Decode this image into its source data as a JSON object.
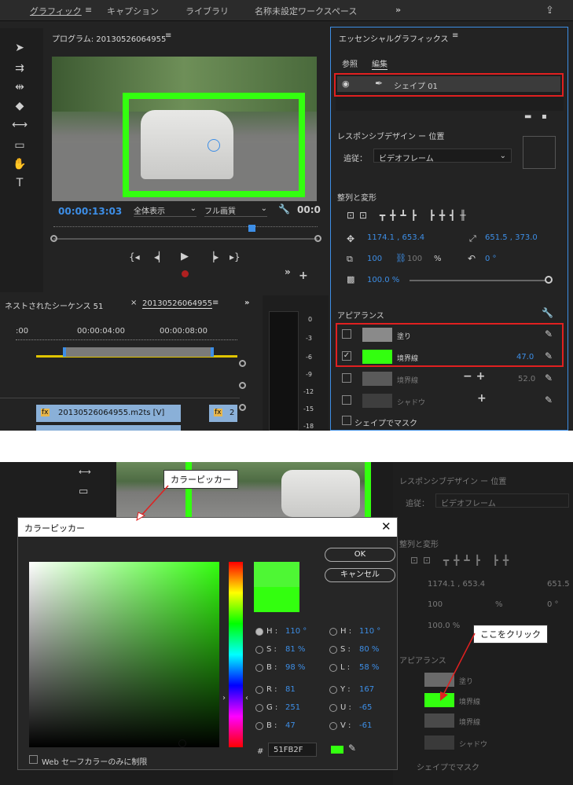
{
  "top": {
    "menu": [
      "グラフィック",
      "キャプション",
      "ライブラリ",
      "名称未設定ワークスペース"
    ],
    "more_glyph": "»",
    "program_title": "プログラム: 20130526064955",
    "timecode": "00:00:13:03",
    "zoom_select": "全体表示",
    "quality_select": "フル画質",
    "timecode_right": "00:0",
    "timeline_tab_left": "ネストされたシーケンス 51",
    "timeline_tab_active": "20130526064955",
    "ruler_labels": [
      ":00",
      "00:00:04:00",
      "00:00:08:00"
    ],
    "clip_label": "20130526064955.m2ts [V]",
    "clip_right_label": "2",
    "meter_labels": [
      "0",
      "-3",
      "-6",
      "-9",
      "-12",
      "-15",
      "-18"
    ],
    "eg": {
      "title": "エッセンシャルグラフィックス",
      "tabs": [
        "参照",
        "編集"
      ],
      "layer_name": "シェイプ 01",
      "responsive_title": "レスポンシブデザイン ー 位置",
      "follow_label": "追従：",
      "follow_value": "ビデオフレーム",
      "align_title": "整列と変形",
      "position": "1174.1 ,  653.4",
      "anchor": "651.5 ,   373.0",
      "scale": "100",
      "scale2": "100",
      "pct": "%",
      "rotation": "0 °",
      "opacity": "100.0 %",
      "appearance_title": "アピアランス",
      "fill_label": "塗り",
      "stroke_label": "境界線",
      "stroke_value": "47.0",
      "stroke2_label": "境界線",
      "stroke2_value": "52.0",
      "shadow_label": "シャドウ",
      "mask_label": "シェイプでマスク"
    },
    "colors": {
      "stroke": "#33ff0f",
      "fill": "#8a8a8a",
      "accent": "#3d8ee6",
      "highlight": "#e02020"
    }
  },
  "bottom": {
    "callout_picker": "カラーピッカー",
    "callout_click": "ここをクリック",
    "dialog_title": "カラーピッカー",
    "ok": "OK",
    "cancel": "キャンセル",
    "hsb": [
      {
        "l": "H :",
        "v": "110 °"
      },
      {
        "l": "S :",
        "v": "81 %"
      },
      {
        "l": "B :",
        "v": "98 %"
      }
    ],
    "hsl": [
      {
        "l": "H :",
        "v": "110 °"
      },
      {
        "l": "S :",
        "v": "80 %"
      },
      {
        "l": "L :",
        "v": "58 %"
      }
    ],
    "rgb": [
      {
        "l": "R :",
        "v": "81"
      },
      {
        "l": "G :",
        "v": "251"
      },
      {
        "l": "B :",
        "v": "47"
      }
    ],
    "yuv": [
      {
        "l": "Y :",
        "v": "167"
      },
      {
        "l": "U :",
        "v": "-65"
      },
      {
        "l": "V :",
        "v": "-61"
      }
    ],
    "hex_label": "#",
    "hex": "51FB2F",
    "web_only": "Web セーフカラーのみに制限",
    "bg": {
      "responsive_title": "レスポンシブデザイン ー 位置",
      "follow_label": "追従：",
      "follow_value": "ビデオフレーム",
      "align_title": "整列と変形",
      "position": "1174.1 ,  653.4",
      "anchor": "651.5",
      "scale": "100",
      "pct": "%",
      "rotation": "0 °",
      "opacity": "100.0 %",
      "appearance_title": "アピアランス",
      "fill_label": "塗り",
      "stroke_label": "境界線",
      "stroke2_label": "境界線",
      "shadow_label": "シャドウ",
      "mask_label": "シェイプでマスク"
    }
  }
}
